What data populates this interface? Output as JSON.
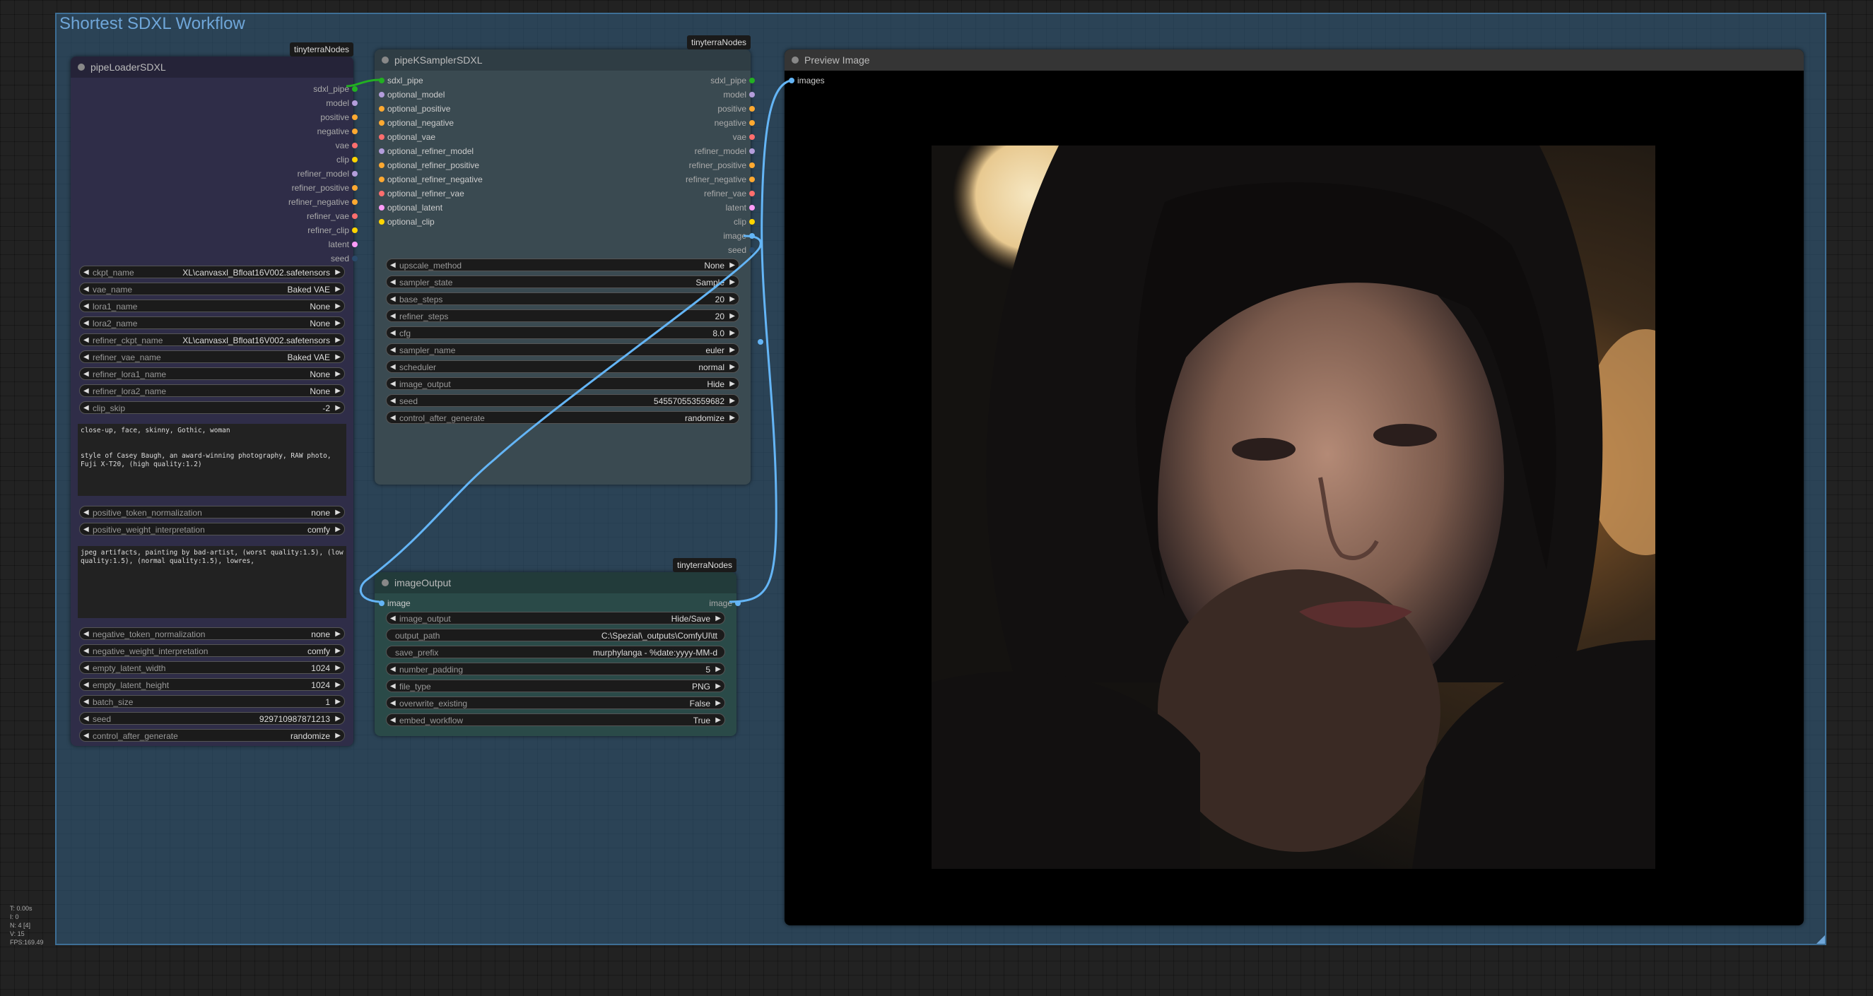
{
  "group": {
    "title": "Shortest SDXL Workflow"
  },
  "loader": {
    "title": "pipeLoaderSDXL",
    "badge": "tinyterraNodes",
    "outputs": [
      {
        "label": "sdxl_pipe",
        "color": "#22b022"
      },
      {
        "label": "model",
        "color": "#b39ddb"
      },
      {
        "label": "positive",
        "color": "#ffa931"
      },
      {
        "label": "negative",
        "color": "#ffa931"
      },
      {
        "label": "vae",
        "color": "#ff6e6e"
      },
      {
        "label": "clip",
        "color": "#ffd500"
      },
      {
        "label": "refiner_model",
        "color": "#b39ddb"
      },
      {
        "label": "refiner_positive",
        "color": "#ffa931"
      },
      {
        "label": "refiner_negative",
        "color": "#ffa931"
      },
      {
        "label": "refiner_vae",
        "color": "#ff6e6e"
      },
      {
        "label": "refiner_clip",
        "color": "#ffd500"
      },
      {
        "label": "latent",
        "color": "#ff9cf9"
      },
      {
        "label": "seed",
        "color": "#2a4a6a"
      }
    ],
    "widgets": [
      {
        "name": "ckpt_name",
        "value": "XL\\canvasxl_Bfloat16V002.safetensors"
      },
      {
        "name": "vae_name",
        "value": "Baked VAE"
      },
      {
        "name": "lora1_name",
        "value": "None"
      },
      {
        "name": "lora2_name",
        "value": "None"
      },
      {
        "name": "refiner_ckpt_name",
        "value": "XL\\canvasxl_Bfloat16V002.safetensors"
      },
      {
        "name": "refiner_vae_name",
        "value": "Baked VAE"
      },
      {
        "name": "refiner_lora1_name",
        "value": "None"
      },
      {
        "name": "refiner_lora2_name",
        "value": "None"
      },
      {
        "name": "clip_skip",
        "value": "-2"
      }
    ],
    "positive_text": "close-up, face, skinny, Gothic, woman\n\n\nstyle of Casey Baugh, an award-winning photography, RAW photo, Fuji X-T20, (high quality:1.2)",
    "widgets2": [
      {
        "name": "positive_token_normalization",
        "value": "none"
      },
      {
        "name": "positive_weight_interpretation",
        "value": "comfy"
      }
    ],
    "negative_text": "jpeg artifacts, painting by bad-artist, (worst quality:1.5), (low quality:1.5), (normal quality:1.5), lowres,",
    "widgets3": [
      {
        "name": "negative_token_normalization",
        "value": "none"
      },
      {
        "name": "negative_weight_interpretation",
        "value": "comfy"
      },
      {
        "name": "empty_latent_width",
        "value": "1024"
      },
      {
        "name": "empty_latent_height",
        "value": "1024"
      },
      {
        "name": "batch_size",
        "value": "1"
      },
      {
        "name": "seed",
        "value": "929710987871213"
      },
      {
        "name": "control_after_generate",
        "value": "randomize"
      }
    ]
  },
  "sampler": {
    "title": "pipeKSamplerSDXL",
    "badge": "tinyterraNodes",
    "inputs": [
      {
        "label": "sdxl_pipe",
        "color": "#22b022"
      },
      {
        "label": "optional_model",
        "color": "#b39ddb"
      },
      {
        "label": "optional_positive",
        "color": "#ffa931"
      },
      {
        "label": "optional_negative",
        "color": "#ffa931"
      },
      {
        "label": "optional_vae",
        "color": "#ff6e6e"
      },
      {
        "label": "optional_refiner_model",
        "color": "#b39ddb"
      },
      {
        "label": "optional_refiner_positive",
        "color": "#ffa931"
      },
      {
        "label": "optional_refiner_negative",
        "color": "#ffa931"
      },
      {
        "label": "optional_refiner_vae",
        "color": "#ff6e6e"
      },
      {
        "label": "optional_latent",
        "color": "#ff9cf9"
      },
      {
        "label": "optional_clip",
        "color": "#ffd500"
      }
    ],
    "outputs": [
      {
        "label": "sdxl_pipe",
        "color": "#22b022"
      },
      {
        "label": "model",
        "color": "#b39ddb"
      },
      {
        "label": "positive",
        "color": "#ffa931"
      },
      {
        "label": "negative",
        "color": "#ffa931"
      },
      {
        "label": "vae",
        "color": "#ff6e6e"
      },
      {
        "label": "refiner_model",
        "color": "#b39ddb"
      },
      {
        "label": "refiner_positive",
        "color": "#ffa931"
      },
      {
        "label": "refiner_negative",
        "color": "#ffa931"
      },
      {
        "label": "refiner_vae",
        "color": "#ff6e6e"
      },
      {
        "label": "latent",
        "color": "#ff9cf9"
      },
      {
        "label": "clip",
        "color": "#ffd500"
      },
      {
        "label": "image",
        "color": "#64b5f6"
      },
      {
        "label": "seed",
        "color": "#2a4a6a"
      }
    ],
    "widgets": [
      {
        "name": "upscale_method",
        "value": "None"
      },
      {
        "name": "sampler_state",
        "value": "Sample"
      },
      {
        "name": "base_steps",
        "value": "20"
      },
      {
        "name": "refiner_steps",
        "value": "20"
      },
      {
        "name": "cfg",
        "value": "8.0"
      },
      {
        "name": "sampler_name",
        "value": "euler"
      },
      {
        "name": "scheduler",
        "value": "normal"
      },
      {
        "name": "image_output",
        "value": "Hide"
      },
      {
        "name": "seed",
        "value": "545570553559682"
      },
      {
        "name": "control_after_generate",
        "value": "randomize"
      }
    ]
  },
  "imageOutput": {
    "title": "imageOutput",
    "badge": "tinyterraNodes",
    "input": {
      "label": "image",
      "color": "#64b5f6"
    },
    "output": {
      "label": "image",
      "color": "#64b5f6"
    },
    "widgets": [
      {
        "name": "image_output",
        "value": "Hide/Save",
        "type": "combo"
      },
      {
        "name": "output_path",
        "value": "C:\\Spezial\\_outputs\\ComfyUI\\tt",
        "type": "text"
      },
      {
        "name": "save_prefix",
        "value": "murphylanga - %date:yyyy-MM-d",
        "type": "text"
      },
      {
        "name": "number_padding",
        "value": "5",
        "type": "combo"
      },
      {
        "name": "file_type",
        "value": "PNG",
        "type": "combo"
      },
      {
        "name": "overwrite_existing",
        "value": "False",
        "type": "combo"
      },
      {
        "name": "embed_workflow",
        "value": "True",
        "type": "combo"
      }
    ]
  },
  "preview": {
    "title": "Preview Image",
    "input": {
      "label": "images",
      "color": "#64b5f6"
    }
  },
  "stats": [
    "T: 0.00s",
    "I: 0",
    "N: 4 [4]",
    "V: 15",
    "FPS:169.49"
  ]
}
